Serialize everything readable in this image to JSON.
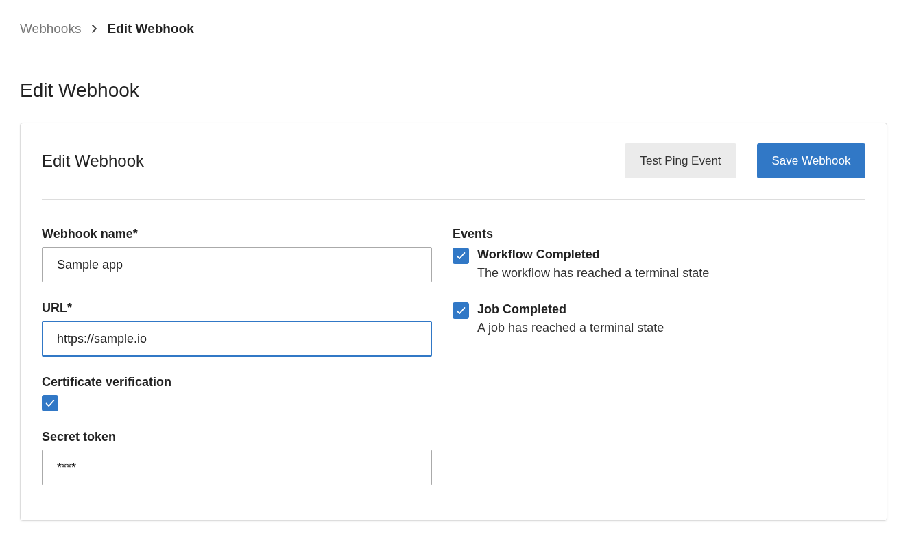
{
  "breadcrumb": [
    {
      "label": "Webhooks",
      "current": false
    },
    {
      "label": "Edit Webhook",
      "current": true
    }
  ],
  "page_title": "Edit Webhook",
  "card": {
    "title": "Edit Webhook",
    "buttons": [
      {
        "label": "Test Ping Event",
        "kind": "secondary"
      },
      {
        "label": "Save Webhook",
        "kind": "primary"
      }
    ]
  },
  "fields": [
    {
      "kind": "text",
      "label": "Webhook name*",
      "value": "Sample app",
      "focused": false
    },
    {
      "kind": "text",
      "label": "URL*",
      "value": "https://sample.io",
      "focused": true
    },
    {
      "kind": "checkbox",
      "label": "Certificate verification",
      "checked": true
    },
    {
      "kind": "text",
      "label": "Secret token",
      "value": "****",
      "focused": false
    }
  ],
  "events": {
    "label": "Events",
    "items": [
      {
        "title": "Workflow Completed",
        "description": "The workflow has reached a terminal state",
        "checked": true
      },
      {
        "title": "Job Completed",
        "description": "A job has reached a terminal state",
        "checked": true
      }
    ]
  }
}
